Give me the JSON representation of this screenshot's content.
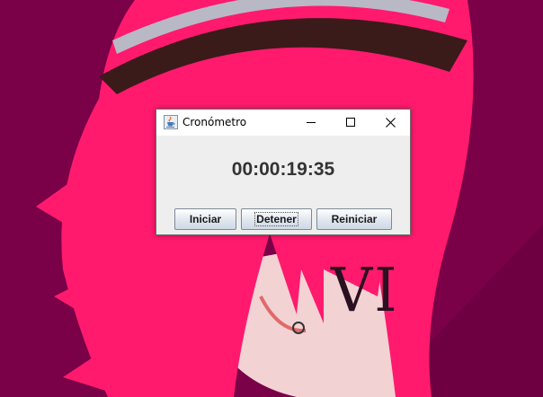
{
  "window": {
    "title": "Cronómetro",
    "app_icon": "java-cup-icon",
    "controls": {
      "minimize": "minimize-icon",
      "maximize": "maximize-icon",
      "close": "close-icon"
    }
  },
  "stopwatch": {
    "time": "00:00:19:35"
  },
  "buttons": {
    "start": "Iniciar",
    "stop": "Detener",
    "reset": "Reiniciar"
  },
  "wallpaper": {
    "numeral": "VI",
    "background_color": "#7a0048",
    "hair_color": "#ff1a6e"
  }
}
